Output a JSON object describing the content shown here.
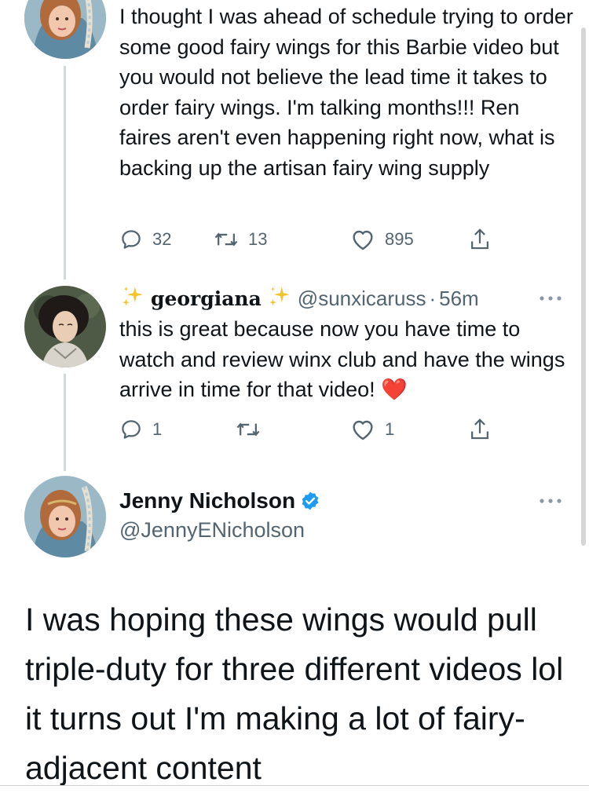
{
  "colors": {
    "text_primary": "#0f1419",
    "text_secondary": "#536471",
    "thread_line": "#cfd9de",
    "verified_blue": "#1d9bf0",
    "heart_red": "#e0245e"
  },
  "tweets": [
    {
      "text": "I thought I was ahead of schedule trying to order some good fairy wings for this Barbie video but you would not believe the lead time it takes to order fairy wings. I'm talking months!!! Ren faires aren't even happening right now, what is backing up the artisan fairy wing supply",
      "replies": "32",
      "retweets": "13",
      "likes": "895"
    },
    {
      "name_prefix_icon": "sparkles-icon",
      "name": "georgiana",
      "name_suffix_icon": "sparkles-icon",
      "handle": "@sunxicaruss",
      "time_separator": "·",
      "time": "56m",
      "text": "this is great because now you have time to watch and review winx club and have the wings arrive in time for that video!",
      "emoji": "❤️",
      "replies": "1",
      "retweets": "",
      "likes": "1"
    }
  ],
  "main_tweet": {
    "name": "Jenny Nicholson",
    "verified_icon": "verified-badge-icon",
    "handle": "@JennyENicholson",
    "text": "I was hoping these wings would pull triple-duty for three different videos lol it turns out I'm making a lot of fairy-adjacent content"
  }
}
